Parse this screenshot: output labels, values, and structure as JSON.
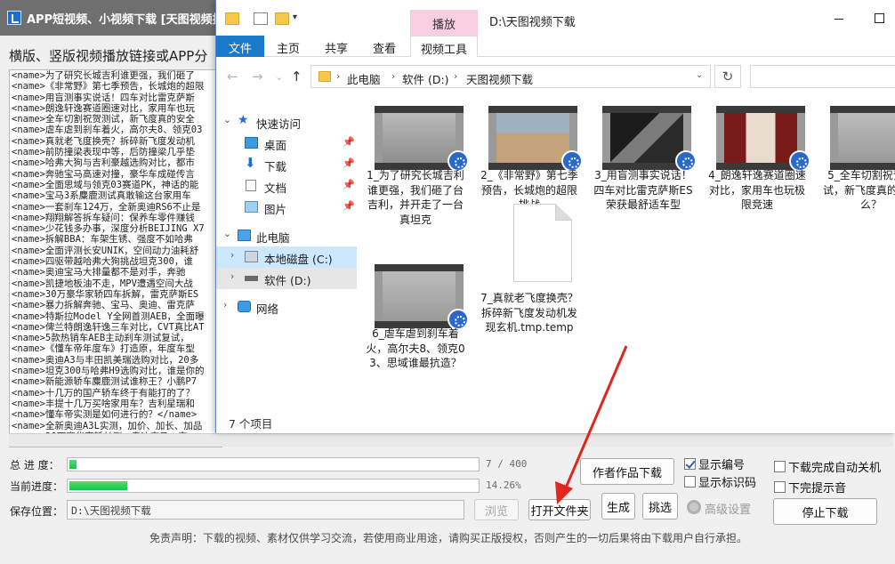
{
  "app": {
    "title": "APP短视频、小视频下载 [天图视频批量",
    "subtitle": "横版、竖版视频播放链接或APP分",
    "list_rows": [
      "<name>为了研究长城吉利谁更强，我们砸了",
      "<name>《非常野》第七季预告，长城炮的超限",
      "<name>用盲测事实说话！四车对比雷克萨斯",
      "<name>朗逸轩逸赛道圈速对比，家用车也玩",
      "<name>全车切割祝贺测试，新飞度真的安全",
      "<name>虐车虐到刹车着火，高尔夫8、领克03",
      "<name>真就老飞度换壳？拆碎新飞度发动机",
      "<name>前防撞梁表现中等，后防撞梁几乎垫",
      "<name>哈弗大狗与吉利豪越选购对比，都市",
      "<name>奔驰宝马高速对撞，豪华车成碰传言",
      "<name>全面思域与领克03赛道PK，神话的能",
      "<name>宝马3系麋鹿测试真敢输这台家用车",
      "<name>一套刹车124万，全新奥迪RS6不止是",
      "<name>翔翔解答拆车疑问：保养车零件赚钱",
      "<name>少花钱多办事，深度分析BEIJING X7",
      "<name>拆解BBA：车架生锈、强度不如哈弗",
      "<name>全面评测长安UNIK，空间动力油耗舒",
      "<name>四驱带越哈弗大狗挑战坦克300，谁",
      "<name>奥迪宝马大排量都不是对手，奔驰",
      "<name>凯捷地板油不走，MPV遭遇空间大战",
      "<name>30万豪华家轿四车拆解，雷克萨斯ES",
      "<name>暴力拆解奔驰、宝马、奥迪、雷克萨",
      "<name>特斯拉Model Y全网首测AEB，全面曝",
      "<name>俾兰特朗逸轩逸三车对比，CVT真比AT",
      "<name>5款热销车AEB主动刹车测试复试，",
      "<name>《懂车帝年度车》打造原，年度车型",
      "<name>奥迪A3与丰田凯美瑞选购对比，20多",
      "<name>坦克300与哈弗H9选购对比，谁是你的",
      "<name>新能源轿车麋鹿测试谁称王？小鹏P7",
      "<name>十几万的国产轿车终于有能打的了？",
      "<name>丰提十几万买啥家用车？吉利星瑞和",
      "<name>懂车帝实测是如何进行的？</name>",
      "<name>全新奥迪A3L实测，加价、加长、加品",
      "<name>20万豪华家轿长测，奥迪宝马、安"
    ],
    "progress": {
      "total_label": "总 进 度：",
      "total_text": "7 / 400",
      "total_fraction": 0.0175,
      "current_label": "当前进度：",
      "current_text": "14.26%",
      "current_fraction": 0.1426
    },
    "save": {
      "label": "保存位置：",
      "path": "D:\\天图视频下载"
    },
    "buttons": {
      "browse": "浏览",
      "open_folder": "打开文件夹",
      "author_works": "作者作品下载",
      "generate": "生成",
      "pick": "挑选",
      "advanced": "高级设置",
      "stop": "停止下载"
    },
    "checkboxes": {
      "show_number": {
        "label": "显示编号",
        "checked": true
      },
      "show_title": {
        "label": "显示标识码",
        "checked": false
      },
      "auto_shutdown": {
        "label": "下载完成自动关机",
        "checked": false
      },
      "sound_alert": {
        "label": "下完提示音",
        "checked": false
      }
    },
    "disclaimer": "免责声明：下载的视频、素材仅供学习交流，若使用商业用途，请购买正版授权，否则产生的一切后果将由下载用户自行承担。"
  },
  "explorer": {
    "title_path": "D:\\天图视频下载",
    "tool_tab": "播放",
    "ribbon_tabs": [
      "文件",
      "主页",
      "共享",
      "查看",
      "视频工具"
    ],
    "breadcrumb": [
      "此电脑",
      "软件 (D:)",
      "天图视频下载"
    ],
    "sidebar": {
      "quick_access": "快速访问",
      "desktop": "桌面",
      "downloads": "下载",
      "documents": "文档",
      "pictures": "图片",
      "this_pc": "此电脑",
      "local_c": "本地磁盘 (C:)",
      "soft_d": "软件 (D:)",
      "network": "网络"
    },
    "status_count": "7 个项目",
    "files": [
      {
        "name": "1_为了研究长城吉利谁更强，我们砸了台吉利，并开走了一台真坦克",
        "kind": "video",
        "thumb": "gray-car"
      },
      {
        "name": "2_《非常野》第七季预告，长城炮的超限挑战",
        "kind": "video",
        "thumb": "desert"
      },
      {
        "name": "3_用盲测事实说话！四车对比雷克萨斯ES荣获最舒适车型",
        "kind": "video",
        "thumb": "car-dark"
      },
      {
        "name": "4_朗逸轩逸赛道圈速对比，家用车也玩极限竞速",
        "kind": "video",
        "thumb": "host"
      },
      {
        "name": "5_全车切割祝贺测试，新飞度真的安全么？",
        "kind": "video",
        "thumb": "plain"
      },
      {
        "name": "6_虐车虐到刹车着火，高尔夫8、领克03、思域谁最抗造？",
        "kind": "video",
        "thumb": "plain"
      },
      {
        "name": "7_真就老飞度换壳？拆碎新飞度发动机发现玄机.tmp.temp",
        "kind": "document",
        "thumb": ""
      }
    ]
  },
  "colors": {
    "ribbon_file": "#1979ca",
    "tool_tab": "#f7cfe0",
    "progress_green": "#18c44a",
    "arrow": "#e0261f",
    "sidebar_selected": "#cce8ff"
  }
}
